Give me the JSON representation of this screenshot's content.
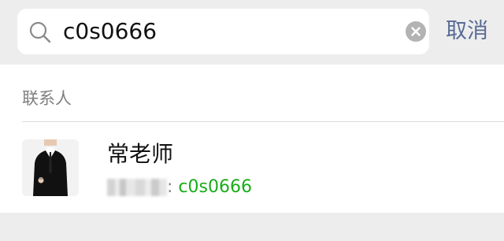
{
  "search": {
    "value": "c0s0666",
    "placeholder": ""
  },
  "header": {
    "cancel_label": "取消"
  },
  "results": {
    "section_title": "联系人",
    "contacts": [
      {
        "name": "常老师",
        "id_separator": ":",
        "matched_id": "c0s0666"
      }
    ]
  },
  "colors": {
    "accent_link": "#576b95",
    "match_highlight": "#1aad19",
    "background": "#ededed"
  },
  "icons": {
    "search": "search-icon",
    "clear": "clear-icon",
    "avatar": "avatar"
  }
}
